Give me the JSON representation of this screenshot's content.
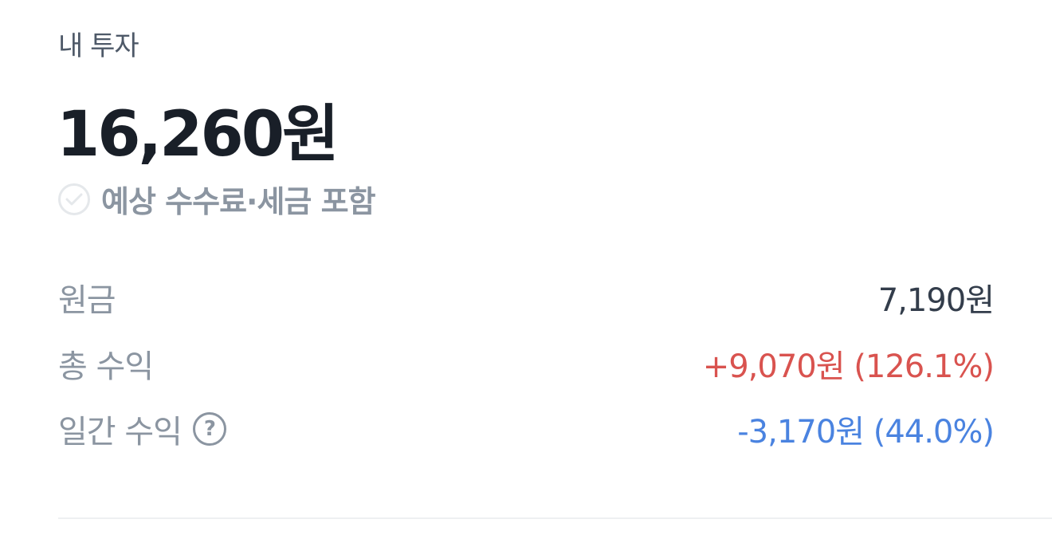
{
  "section": {
    "title": "내 투자"
  },
  "summary": {
    "total_amount": "16,260원",
    "fee_toggle_label": "예상 수수료·세금 포함",
    "fee_toggle_checked": false
  },
  "rows": {
    "principal": {
      "label": "원금",
      "value": "7,190원"
    },
    "total_return": {
      "label": "총 수익",
      "value": "+9,070원 (126.1%)"
    },
    "daily_return": {
      "label": "일간 수익",
      "value": "-3,170원 (44.0%)"
    }
  },
  "icons": {
    "check": "check-circle-icon",
    "help": "question-circle-icon",
    "help_glyph": "?"
  },
  "colors": {
    "text_primary": "#191f28",
    "text_secondary": "#8b95a1",
    "profit": "#d9534f",
    "loss": "#4a83e0"
  }
}
